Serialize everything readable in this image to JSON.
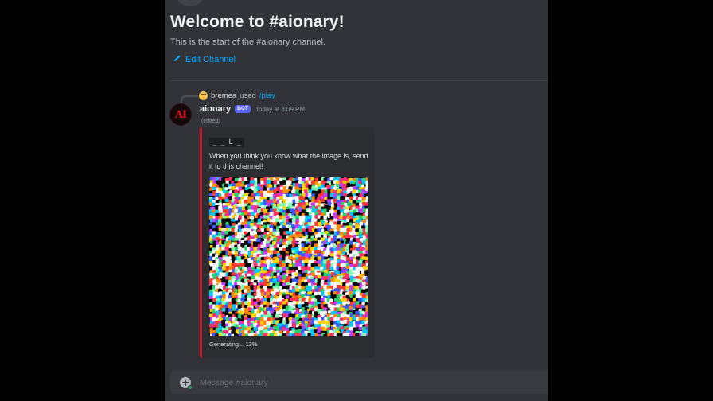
{
  "channel": {
    "welcome_title": "Welcome to #aionary!",
    "welcome_subtitle": "This is the start of the #aionary channel.",
    "edit_channel_label": "Edit Channel"
  },
  "reply": {
    "user": "bremea",
    "used_text": "used",
    "command": "/play"
  },
  "message": {
    "avatar_text": "AI",
    "author": "aionary",
    "bot_tag": "BOT",
    "timestamp": "Today at 8:09 PM",
    "edited": "(edited)",
    "embed": {
      "accent_color": "#c51b28",
      "hint": "_ _ L _",
      "description": "When you think you know what the image is, send it to this channel!",
      "footer": "Generating... 13%",
      "progress": 0.13
    }
  },
  "composer": {
    "placeholder": "Message #aionary"
  },
  "colors": {
    "background": "#313338",
    "link": "#00a8fc",
    "bot_tag": "#5865f2"
  }
}
